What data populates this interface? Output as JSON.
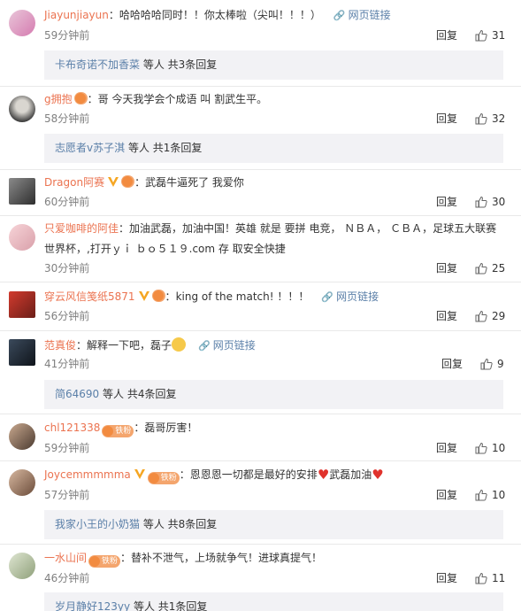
{
  "ui": {
    "reply_label": "回复",
    "web_link_label": "网页链接"
  },
  "comments": [
    {
      "user": "Jiayunjiayun",
      "text": "哈哈哈哈同时！！你太棒啦（尖叫！！！）",
      "time": "59分钟前",
      "likes": "31",
      "sub": {
        "user": "卡布奇诺不加香菜",
        "rest": "等人 共3条回复"
      }
    },
    {
      "user": "g拥抱",
      "text": "哥 今天我学会个成语 叫 割武生平。",
      "time": "58分钟前",
      "likes": "32",
      "sub": {
        "user": "志愿者v苏子淇",
        "rest": "等人 共1条回复"
      }
    },
    {
      "user": "Dragon阿赛",
      "text": "武磊牛逼死了 我爱你",
      "time": "60分钟前",
      "likes": "30"
    },
    {
      "user": "只爱咖啡的阿佳",
      "text": "加油武磊，加油中国！英雄 就是 要拼 电竞， ＮＢＡ， ＣＢＡ，足球五大联赛",
      "text2": "世界杯，,打开ｙｉ ｂｏ５１９.com 存 取安全快捷",
      "time": "30分钟前",
      "likes": "25"
    },
    {
      "user": "穿云风信笺纸5871",
      "text": "king of the match! ！！！",
      "time": "56分钟前",
      "likes": "29"
    },
    {
      "user": "范真俊",
      "text": "解释一下吧，磊子",
      "time": "41分钟前",
      "likes": "9",
      "sub": {
        "user": "简64690",
        "rest": "等人 共4条回复"
      }
    },
    {
      "user": "chl121338",
      "text": "磊哥厉害！",
      "time": "59分钟前",
      "likes": "10",
      "badge": "铁粉"
    },
    {
      "user": "Joycemmmmma",
      "text": "恩恩恩一切都是最好的安排",
      "text_after": "武磊加油",
      "time": "57分钟前",
      "likes": "10",
      "badge": "铁粉",
      "sub": {
        "user": "我家小王的小奶猫",
        "rest": "等人 共8条回复"
      }
    },
    {
      "user": "一水山间",
      "text": "替补不泄气，上场就争气！进球真提气！",
      "time": "46分钟前",
      "likes": "11",
      "badge": "铁粉",
      "sub": {
        "user": "岁月静好123yy",
        "rest": "等人 共1条回复"
      }
    }
  ],
  "colors": {
    "username": "#eb7350",
    "link": "#5a7fa8",
    "sub_bg": "#f2f2f5",
    "muted": "#808080"
  }
}
